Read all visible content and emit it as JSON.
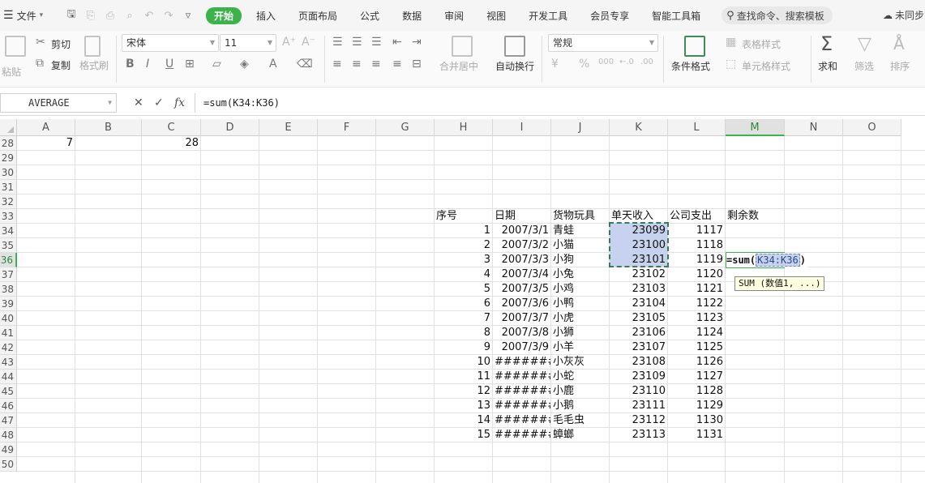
{
  "menubar": {
    "file_label": "文件",
    "tabs": [
      "开始",
      "插入",
      "页面布局",
      "公式",
      "数据",
      "审阅",
      "视图",
      "开发工具",
      "会员专享",
      "智能工具箱"
    ],
    "search_placeholder": "查找命令、搜索模板",
    "cloud_label": "未同步"
  },
  "ribbon": {
    "paste": "粘贴",
    "cut": "剪切",
    "copy": "复制",
    "format_painter": "格式刷",
    "font_name": "宋体",
    "font_size": "11",
    "merge_center": "合并居中",
    "wrap_text": "自动换行",
    "number_format": "常规",
    "conditional_format": "条件格式",
    "table_style": "表格样式",
    "cell_style": "单元格样式",
    "sum": "求和",
    "filter": "筛选",
    "sort": "排序",
    "percent": "%",
    "thousands": "000"
  },
  "formula_bar": {
    "name_box": "AVERAGE",
    "formula": "=sum(K34:K36)"
  },
  "columns": [
    "A",
    "B",
    "C",
    "D",
    "E",
    "F",
    "G",
    "H",
    "I",
    "J",
    "K",
    "L",
    "M",
    "N",
    "O"
  ],
  "selected_column": "M",
  "rows": [
    "28",
    "29",
    "30",
    "31",
    "32",
    "33",
    "34",
    "35",
    "36",
    "37",
    "38",
    "39",
    "40",
    "41",
    "42",
    "43",
    "44",
    "45",
    "46",
    "47",
    "48",
    "49",
    "50"
  ],
  "selected_row": "36",
  "row28": {
    "A": "7",
    "C": "28"
  },
  "table": {
    "headers": {
      "H": "序号",
      "I": "日期",
      "J": "货物玩具",
      "K": "单天收入",
      "L": "公司支出",
      "M": "剩余数"
    },
    "records": [
      {
        "H": "1",
        "I": "2007/3/1",
        "J": "青蛙",
        "K": "23099",
        "L": "1117"
      },
      {
        "H": "2",
        "I": "2007/3/2",
        "J": "小猫",
        "K": "23100",
        "L": "1118"
      },
      {
        "H": "3",
        "I": "2007/3/3",
        "J": "小狗",
        "K": "23101",
        "L": "1119"
      },
      {
        "H": "4",
        "I": "2007/3/4",
        "J": "小兔",
        "K": "23102",
        "L": "1120"
      },
      {
        "H": "5",
        "I": "2007/3/5",
        "J": "小鸡",
        "K": "23103",
        "L": "1121"
      },
      {
        "H": "6",
        "I": "2007/3/6",
        "J": "小鸭",
        "K": "23104",
        "L": "1122"
      },
      {
        "H": "7",
        "I": "2007/3/7",
        "J": "小虎",
        "K": "23105",
        "L": "1123"
      },
      {
        "H": "8",
        "I": "2007/3/8",
        "J": "小狮",
        "K": "23106",
        "L": "1124"
      },
      {
        "H": "9",
        "I": "2007/3/9",
        "J": "小羊",
        "K": "23107",
        "L": "1125"
      },
      {
        "H": "10",
        "I": "########",
        "J": "小灰灰",
        "K": "23108",
        "L": "1126"
      },
      {
        "H": "11",
        "I": "########",
        "J": "小蛇",
        "K": "23109",
        "L": "1127"
      },
      {
        "H": "12",
        "I": "########",
        "J": "小鹿",
        "K": "23110",
        "L": "1128"
      },
      {
        "H": "13",
        "I": "########",
        "J": "小鹅",
        "K": "23111",
        "L": "1129"
      },
      {
        "H": "14",
        "I": "########",
        "J": "毛毛虫",
        "K": "23112",
        "L": "1130"
      },
      {
        "H": "15",
        "I": "########",
        "J": "蟑螂",
        "K": "23113",
        "L": "1131"
      }
    ]
  },
  "editing": {
    "prefix": "=sum(",
    "ref": "K34:K36",
    "suffix": ")",
    "tooltip": "SUM (数值1, ...)"
  },
  "colors": {
    "accent": "#3bb34a",
    "selection": "#c7d3ee"
  }
}
